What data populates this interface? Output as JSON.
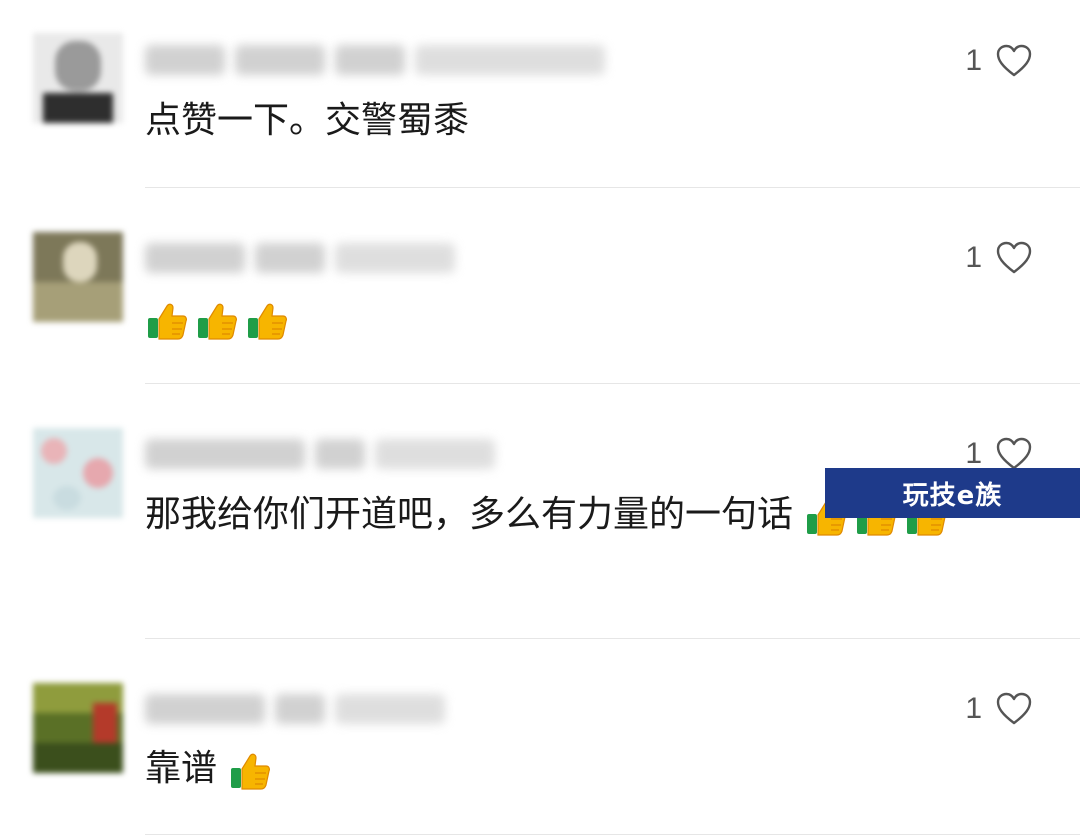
{
  "comments": [
    {
      "like_count": "1",
      "text": "点赞一下。交警蜀黍",
      "thumbs": 0,
      "avatar_colors": [
        "#e8e8e8",
        "#cfcfcf",
        "#6b6b6b",
        "#3a3a3a"
      ]
    },
    {
      "like_count": "1",
      "text": "",
      "thumbs": 3,
      "avatar_colors": [
        "#6c6a4e",
        "#a9a27a",
        "#d9d2b8",
        "#8a8460"
      ]
    },
    {
      "like_count": "1",
      "text": "那我给你们开道吧，多么有力量的一句话",
      "thumbs": 3,
      "avatar_colors": [
        "#cfe3e6",
        "#e7b9bd",
        "#d6d9cf",
        "#b8d0d6"
      ]
    },
    {
      "like_count": "1",
      "text": "靠谱",
      "thumbs": 1,
      "avatar_colors": [
        "#3f5a22",
        "#7c8a35",
        "#b23a2b",
        "#56702c"
      ]
    }
  ],
  "watermark": "玩技e族",
  "colors": {
    "accent": "#1e3a8a",
    "divider": "#e6e6e6",
    "heart": "#555555"
  }
}
